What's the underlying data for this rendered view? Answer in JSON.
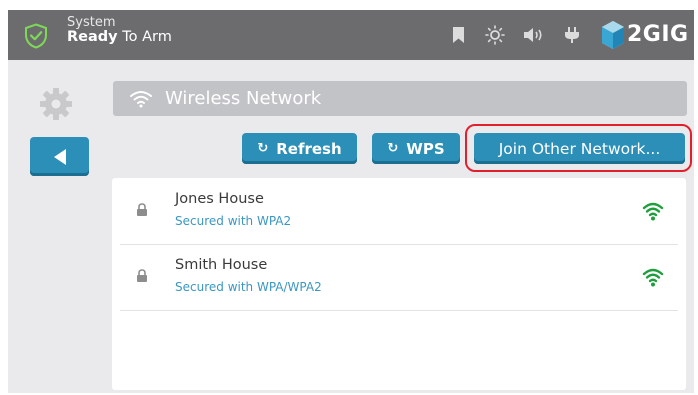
{
  "header": {
    "status_line1": "System",
    "status_bold": "Ready",
    "status_rest": " To Arm",
    "brand": "2GIG",
    "icons": [
      "shield-check-icon",
      "bookmark-icon",
      "brightness-icon",
      "volume-icon",
      "power-plug-icon",
      "brand-cube-icon"
    ]
  },
  "page": {
    "title": "Wireless Network"
  },
  "buttons": {
    "refresh": "Refresh",
    "wps": "WPS",
    "join": "Join Other Network..."
  },
  "networks": [
    {
      "name": "Jones House",
      "security": "Secured with WPA2",
      "icon": "lock-icon",
      "signal": "wifi-strong-icon"
    },
    {
      "name": "Smith House",
      "security": "Secured with WPA/WPA2",
      "icon": "lock-icon",
      "signal": "wifi-strong-icon"
    }
  ],
  "colors": {
    "header_bg": "#6c6c6e",
    "screen_bg": "#eaeaec",
    "button": "#2b8fb7",
    "highlight": "#e11f2d",
    "signal": "#1f9e3e",
    "security_text": "#3b97c2"
  }
}
